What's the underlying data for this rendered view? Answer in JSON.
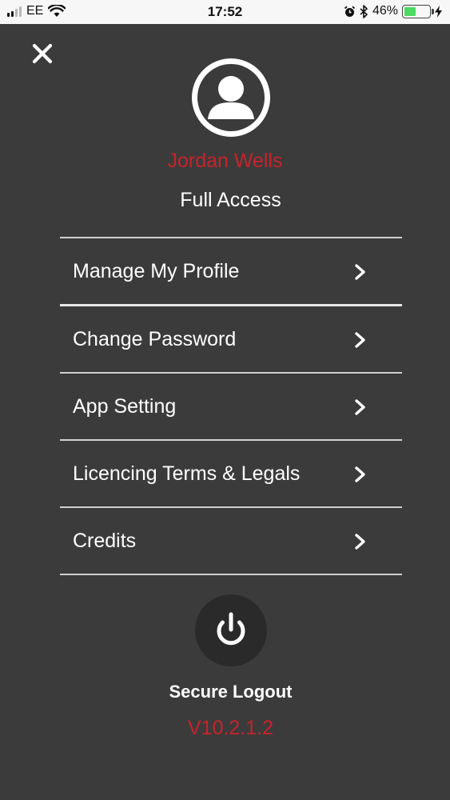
{
  "status_bar": {
    "carrier": "EE",
    "time": "17:52",
    "battery_percent_text": "46%",
    "battery_level": 0.46,
    "icons": [
      "signal-icon",
      "wifi-icon",
      "alarm-icon",
      "bluetooth-icon",
      "battery-icon",
      "charging-icon"
    ]
  },
  "header": {
    "close_icon": "close-icon",
    "avatar_icon": "user-avatar-icon"
  },
  "user": {
    "name": "Jordan Wells",
    "access": "Full Access"
  },
  "menu": {
    "items": [
      {
        "label": "Manage My Profile",
        "icon": "chevron-right-icon"
      },
      {
        "label": "Change Password",
        "icon": "chevron-right-icon"
      },
      {
        "label": "App Setting",
        "icon": "chevron-right-icon"
      },
      {
        "label": "Licencing Terms & Legals",
        "icon": "chevron-right-icon"
      },
      {
        "label": "Credits",
        "icon": "chevron-right-icon"
      }
    ]
  },
  "logout": {
    "label": "Secure Logout",
    "icon": "power-icon"
  },
  "version": "V10.2.1.2",
  "colors": {
    "background": "#3c3b3c",
    "accent_red": "#c4242a",
    "text": "#ffffff",
    "logout_circle": "#2b2a2b",
    "battery_green": "#4cd964"
  }
}
